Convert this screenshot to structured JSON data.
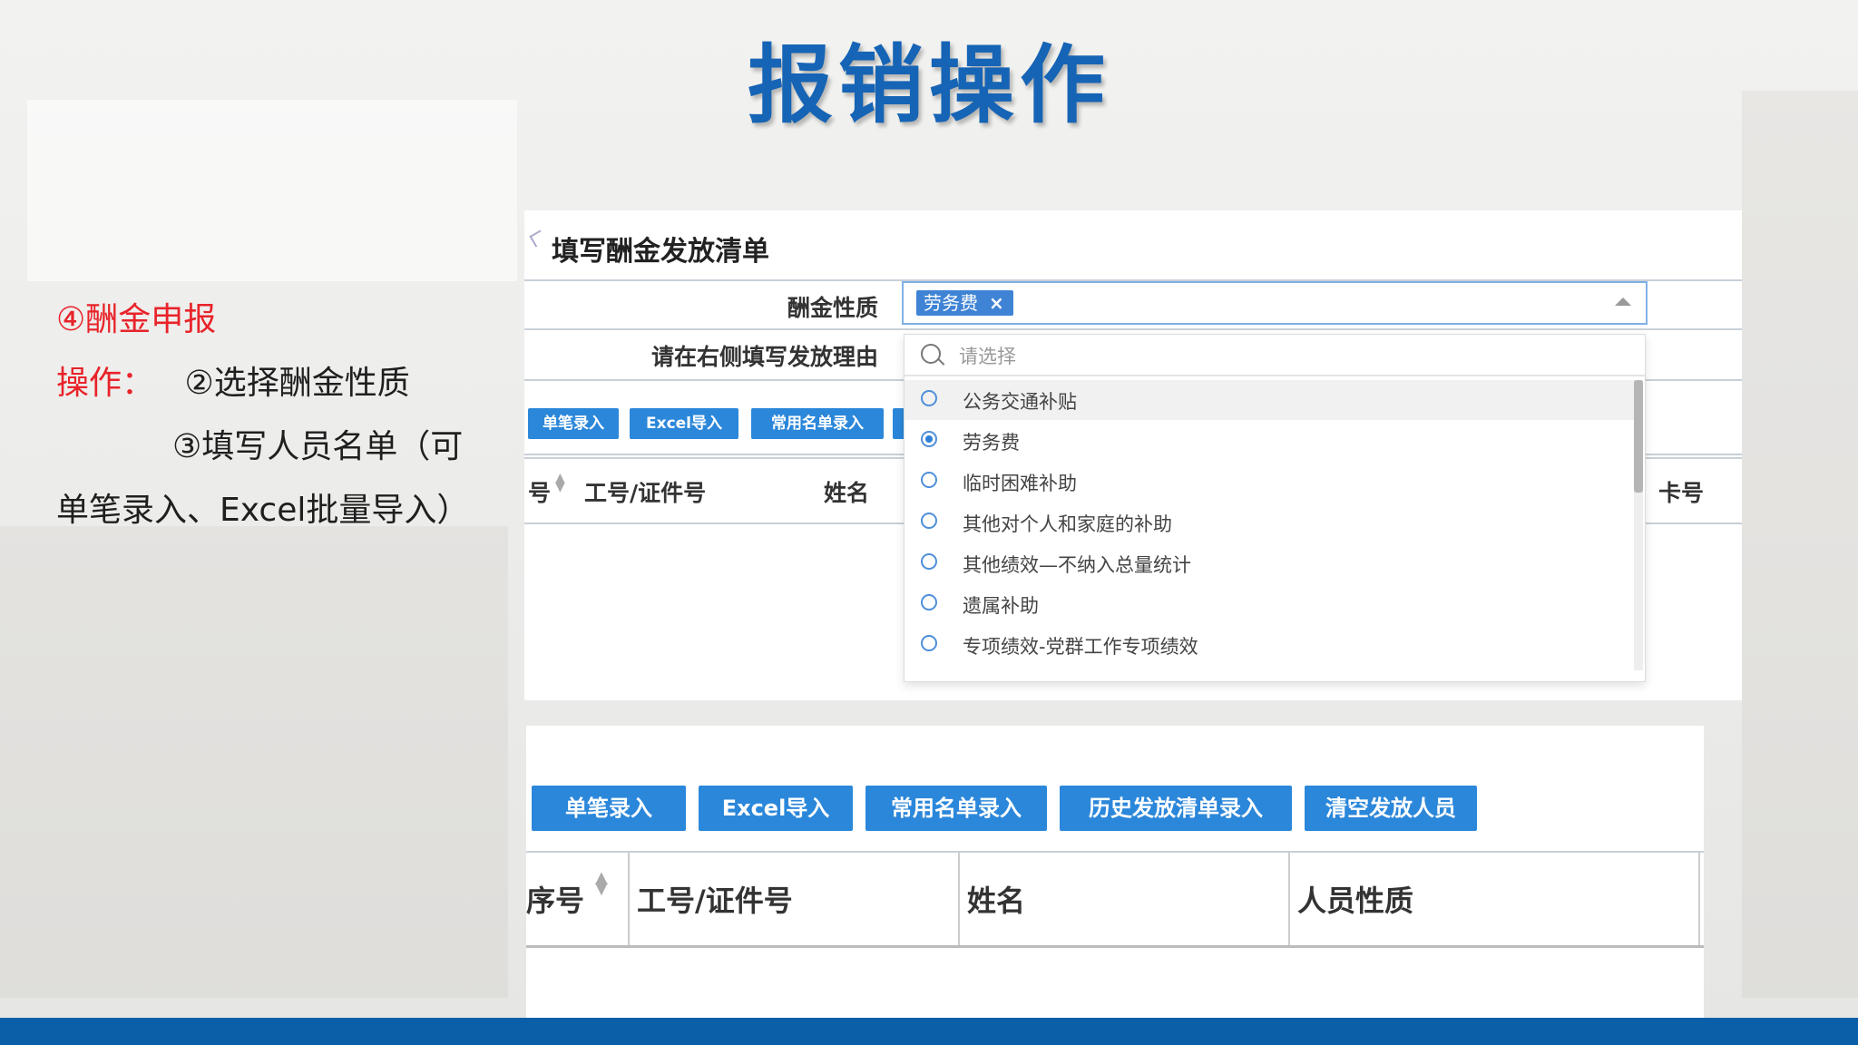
{
  "slide": {
    "title": "报销操作",
    "step_heading": "④酬金申报",
    "op_label": "操作：",
    "op_step1": "②选择酬金性质",
    "op_step2_a": "③填写人员名单（可",
    "op_step2_b": "单笔录入、Excel批量导入）"
  },
  "form": {
    "title": "填写酬金发放清单",
    "nature_label": "酬金性质",
    "reason_label": "请在右侧填写发放理由",
    "selected_tag": "劳务费",
    "tag_close": "×",
    "search_placeholder": "请选择"
  },
  "buttons_top": [
    "单笔录入",
    "Excel导入",
    "常用名单录入"
  ],
  "table_top": {
    "col_seq_partial": "号",
    "col_id": "工号/证件号",
    "col_name": "姓名",
    "col_card_partial": "卡号"
  },
  "dropdown_options": [
    {
      "label": "公务交通补贴",
      "selected": false,
      "hover": true
    },
    {
      "label": "劳务费",
      "selected": true,
      "hover": false
    },
    {
      "label": "临时困难补助",
      "selected": false,
      "hover": false
    },
    {
      "label": "其他对个人和家庭的补助",
      "selected": false,
      "hover": false
    },
    {
      "label": "其他绩效—不纳入总量统计",
      "selected": false,
      "hover": false
    },
    {
      "label": "遗属补助",
      "selected": false,
      "hover": false
    },
    {
      "label": "专项绩效-党群工作专项绩效",
      "selected": false,
      "hover": false
    }
  ],
  "buttons_bottom": [
    "单笔录入",
    "Excel导入",
    "常用名单录入",
    "历史发放清单录入",
    "清空发放人员"
  ],
  "table_bottom": {
    "col_seq": "序号",
    "col_id": "工号/证件号",
    "col_name": "姓名",
    "col_type": "人员性质"
  },
  "colors": {
    "title": "#1664b5",
    "highlight": "#e8232a",
    "button": "#2b87da",
    "footer": "#0b5ea8"
  }
}
